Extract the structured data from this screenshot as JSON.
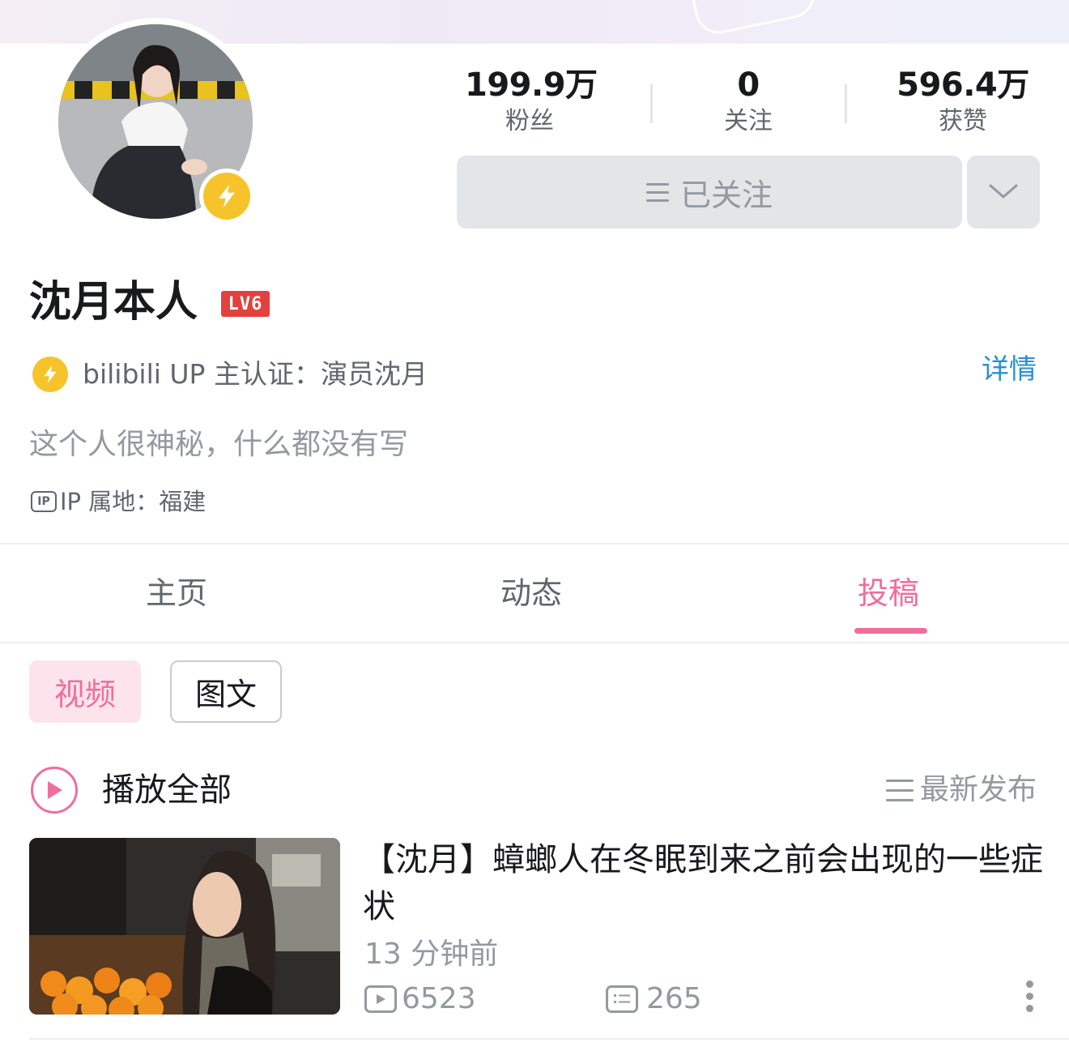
{
  "profile": {
    "name": "沈月本人",
    "level": "LV6",
    "certification": "bilibili UP 主认证：演员沈月",
    "detail_link": "详情",
    "signature": "这个人很神秘，什么都没有写",
    "ip_location": "IP 属地：福建",
    "ip_icon_label": "IP"
  },
  "stats": [
    {
      "value": "199.9万",
      "label": "粉丝"
    },
    {
      "value": "0",
      "label": "关注"
    },
    {
      "value": "596.4万",
      "label": "获赞"
    }
  ],
  "actions": {
    "follow_label": "已关注"
  },
  "tabs": [
    {
      "label": "主页",
      "active": false
    },
    {
      "label": "动态",
      "active": false
    },
    {
      "label": "投稿",
      "active": true
    }
  ],
  "filters": [
    {
      "label": "视频",
      "active": true
    },
    {
      "label": "图文",
      "active": false
    }
  ],
  "list_header": {
    "play_all": "播放全部",
    "sort": "最新发布"
  },
  "videos": [
    {
      "title": "【沈月】蟑螂人在冬眠到来之前会出现的一些症状",
      "time": "13 分钟前",
      "views": "6523",
      "comments": "265"
    }
  ],
  "colors": {
    "accent_pink": "#f06e9b",
    "link_blue": "#2a90d0",
    "badge_yellow": "#f6c42a",
    "level_red": "#e3413d"
  },
  "icons": [
    "lightning-icon",
    "menu-lines-icon",
    "chevron-down-icon",
    "ip-icon",
    "play-circle-icon",
    "sort-icon",
    "play-count-icon",
    "comment-icon",
    "more-vertical-icon"
  ]
}
